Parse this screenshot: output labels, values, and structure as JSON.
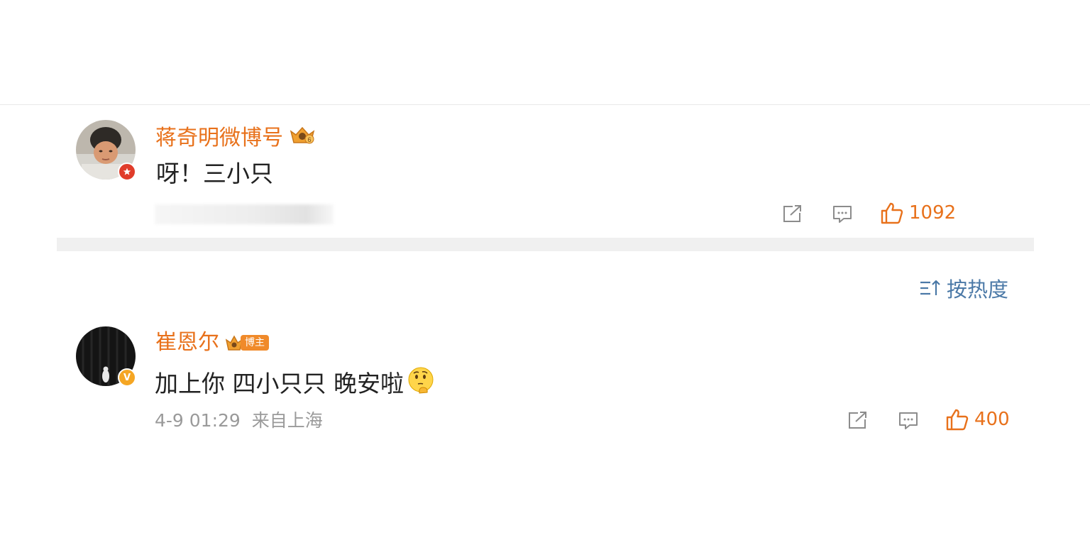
{
  "colors": {
    "username": "#e8711b",
    "text": "#222222",
    "meta": "#9a9a9a",
    "icon": "#8c8c8c",
    "like": "#e8711b",
    "sort": "#4b79a7",
    "badge_red": "#e03c2a",
    "badge_gold": "#f5a623"
  },
  "comment_1": {
    "username": "蒋奇明微博号",
    "badge_icon": "crown-level-badge-icon",
    "avatar_badge_icon": "red-star-badge-icon",
    "text": "呀！三小只",
    "likes": "1092"
  },
  "sort": {
    "icon": "sort-icon",
    "label": "按热度"
  },
  "comment_2": {
    "username": "崔恩尔",
    "badge_icon": "crown-host-badge-icon",
    "badge_label": "博主",
    "avatar_badge_icon": "gold-verified-badge-icon",
    "avatar_badge_letter": "V",
    "text": "加上你 四小只只 晚安啦",
    "emoji": "thinking-face-emoji",
    "time": "4-9 01:29",
    "location": "来自上海",
    "likes": "400"
  }
}
